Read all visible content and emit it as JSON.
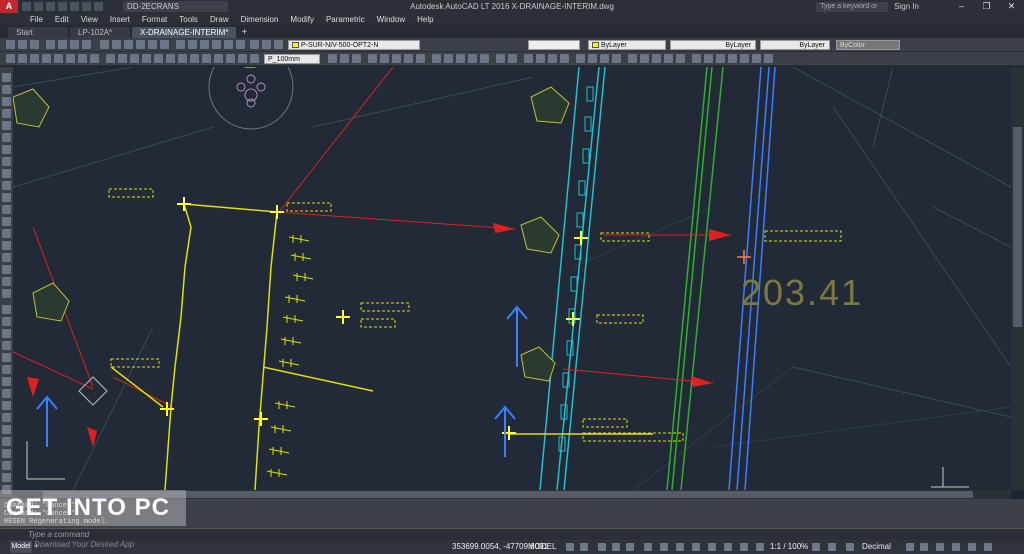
{
  "app": {
    "title": "Autodesk AutoCAD LT 2016    X-DRAINAGE-INTERIM.dwg",
    "logo": "A",
    "workspace": "DD-2ECRANS",
    "search_placeholder": "Type a keyword or phrase",
    "sign_in": "Sign In"
  },
  "menu": [
    "File",
    "Edit",
    "View",
    "Insert",
    "Format",
    "Tools",
    "Draw",
    "Dimension",
    "Modify",
    "Parametric",
    "Window",
    "Help"
  ],
  "tabs": [
    {
      "label": "Start",
      "active": false
    },
    {
      "label": "LP-102A*",
      "active": false
    },
    {
      "label": "X-DRAINAGE-INTERIM*",
      "active": true
    }
  ],
  "properties": {
    "layer": "P-SUR-NIV-500-OPT2-N",
    "color": "ByLayer",
    "linetype": "ByLayer",
    "lineweight": "ByLayer",
    "plotstyle": "ByColor",
    "dimstyle": "P_100mm"
  },
  "drawing": {
    "elevation_text": "203.41"
  },
  "command": {
    "lines": [
      "Command: *Cancel*",
      "Command: *Cancel*",
      "REGEN Regenerating model."
    ],
    "placeholder": "Type a command"
  },
  "status": {
    "layout_tab": "Model",
    "coordinates": "353699.0054, -47709.6091",
    "model_btn": "MODEL",
    "scale": "1:1 / 100%",
    "units": "Decimal"
  },
  "watermark": {
    "text": "GET INTO PC",
    "sub": "Download Your Desired App"
  }
}
